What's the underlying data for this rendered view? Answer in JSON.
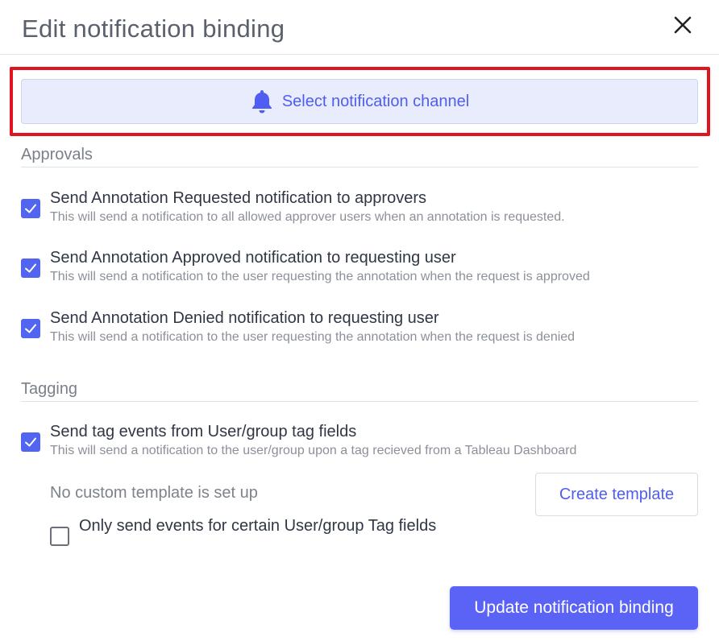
{
  "dialog": {
    "title": "Edit notification binding"
  },
  "channel": {
    "label": "Select notification channel",
    "icon": "bell-icon",
    "accent": "#4f5df0"
  },
  "approvals": {
    "title": "Approvals",
    "items": [
      {
        "title": "Send Annotation Requested notification to approvers",
        "description": "This will send a notification to all allowed approver users when an annotation is requested.",
        "checked": true
      },
      {
        "title": "Send Annotation Approved notification to requesting user",
        "description": "This will send a notification to the user requesting the annotation when the request is approved",
        "checked": true
      },
      {
        "title": "Send Annotation Denied notification to requesting user",
        "description": "This will send a notification to the user requesting the annotation when the request is denied",
        "checked": true
      }
    ]
  },
  "tagging": {
    "title": "Tagging",
    "item": {
      "title": "Send tag events from User/group tag fields",
      "description": "This will send a notification to the user/group upon a tag recieved from a Tableau Dashboard",
      "checked": true
    },
    "no_template_text": "No custom template is set up",
    "create_template_label": "Create template",
    "filter_option": {
      "label": "Only send events for certain User/group Tag fields",
      "checked": false
    }
  },
  "footer": {
    "update_label": "Update notification binding"
  },
  "colors": {
    "primary": "#5a63f5",
    "highlight": "#e0141e"
  }
}
